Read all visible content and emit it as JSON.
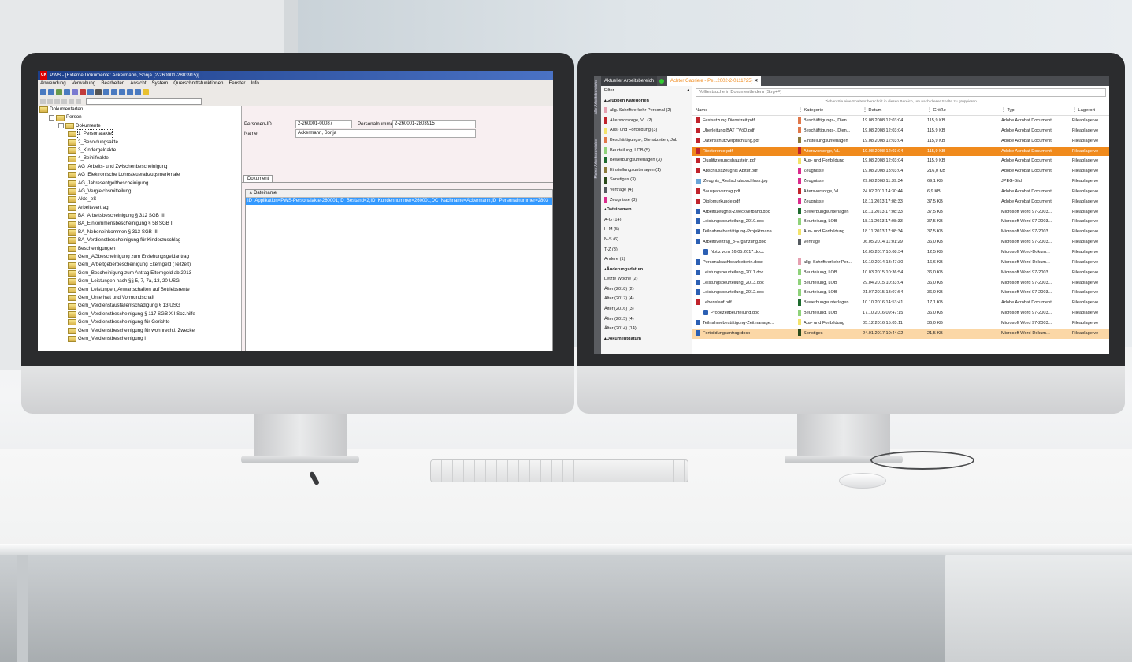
{
  "left_app": {
    "title": "PWS - [Externe Dokumente: Ackermann, Sonja (2-260001-2803915)]",
    "badge": "CK",
    "menu": [
      "Anwendung",
      "Verwaltung",
      "Bearbeiten",
      "Ansicht",
      "System",
      "Querschnittsfunktionen",
      "Fenster",
      "Info"
    ],
    "tree": [
      {
        "label": "Dokumentarten",
        "level": 0
      },
      {
        "label": "Person",
        "level": 1
      },
      {
        "label": "Dokumente",
        "level": 2
      },
      {
        "label": "1_Personalakte",
        "level": 3,
        "selected": true
      },
      {
        "label": "2_Besoldungsakte",
        "level": 3
      },
      {
        "label": "3_Kindergeldakte",
        "level": 3
      },
      {
        "label": "4_Beihilfeakte",
        "level": 3
      },
      {
        "label": "AG_Arbeits- und Zwischenbescheinigung",
        "level": 3
      },
      {
        "label": "AG_Elektronische Lohnsteuerabzugsmerkmale",
        "level": 3
      },
      {
        "label": "AG_Jahresentgeltbescheinigung",
        "level": 3
      },
      {
        "label": "AG_Vergleichsmitteilung",
        "level": 3
      },
      {
        "label": "Akte_eS",
        "level": 3
      },
      {
        "label": "Arbeitsvertrag",
        "level": 3
      },
      {
        "label": "BA_Arbeitsbescheinigung § 312 SGB III",
        "level": 3
      },
      {
        "label": "BA_Einkommensbescheinigung § 58 SGB II",
        "level": 3
      },
      {
        "label": "BA_Nebeneinkommen § 313 SGB III",
        "level": 3
      },
      {
        "label": "BA_Verdienstbescheinigung für Kinderzuschlag",
        "level": 3
      },
      {
        "label": "Bescheinigungen",
        "level": 3
      },
      {
        "label": "Gem_AGbescheinigung zum Erziehungsgeldantrag",
        "level": 3
      },
      {
        "label": "Gem_Arbeitgeberbescheinigung Elterngeld (Teilzeit)",
        "level": 3
      },
      {
        "label": "Gem_Bescheinigung zum Antrag  Elterngeld ab 2013",
        "level": 3
      },
      {
        "label": "Gem_Leistungen nach §§ 5, 7, 7a, 13, 20 USG",
        "level": 3
      },
      {
        "label": "Gem_Leistungen, Anwartschaften auf Betriebsrente",
        "level": 3
      },
      {
        "label": "Gem_Unterhalt und Vormundschaft",
        "level": 3
      },
      {
        "label": "Gem_Verdienstausfallentschädigung § 13 USG",
        "level": 3
      },
      {
        "label": "Gem_Verdienstbescheinigung § 117 SGB XII Soz.hilfe",
        "level": 3
      },
      {
        "label": "Gem_Verdienstbescheinigung für Gerichte",
        "level": 3
      },
      {
        "label": "Gem_Verdienstbescheinigung für wohnrechtl. Zwecke",
        "level": 3
      },
      {
        "label": "Gem_Verdienstbescheinigung I",
        "level": 3
      }
    ],
    "detail": {
      "personen_id_label": "Personen-ID",
      "personen_id_value": "2-260001-00087",
      "personalnummer_label": "Personalnummer",
      "personalnummer_value": "2-260001-2803915",
      "name_label": "Name",
      "name_value": "Ackermann, Sonja",
      "dokument_tab": "Dokument",
      "grid_header": "Dateiname",
      "grid_row": "ID_Applikation=PWS-Personalakte-260001;ID_Bestand=2;ID_Kundennummer=260001;DC_Nachname=Ackermann;ID_Personalnummer=2803"
    }
  },
  "right_app": {
    "tab_workspace": "Aktueller Arbeitsbereich",
    "tab_document": "Achter Gabriele - Pe...2002-2-0111725)",
    "side_labels": [
      "Alle Arbeitsbereiche",
      "Meine Arbeitsbereiche"
    ],
    "filter_label": "Filter",
    "search_placeholder": "Volltextsuche in Dokumentfeldern (Strg+F)",
    "group_hint": "Ziehen Sie eine Spaltenüberschrift in diesen Bereich, um nach dieser Spalte zu gruppieren",
    "filters": [
      {
        "label": "Gruppen Kategorien",
        "head": true
      },
      {
        "label": "allg. Schriftverkehr Personal (2)",
        "color": "#e5a0b0"
      },
      {
        "label": "Altersvorsorge, VL (2)",
        "color": "#c0232b"
      },
      {
        "label": "Aus- und Fortbildung (3)",
        "color": "#f3e36a"
      },
      {
        "label": "Beschäftigungs-, Dienstzeiten, Jub",
        "color": "#e0784a"
      },
      {
        "label": "Beurteilung, LOB (5)",
        "color": "#8fd27a"
      },
      {
        "label": "Bewerbungsunterlagen (3)",
        "color": "#1e6b2e"
      },
      {
        "label": "Einstellungsunterlagen (1)",
        "color": "#8a7a3a"
      },
      {
        "label": "Sonstiges (3)",
        "color": "#2a4a1a"
      },
      {
        "label": "Verträge (4)",
        "color": "#555a60"
      },
      {
        "label": "Zeugnisse (3)",
        "color": "#d92a8c"
      },
      {
        "label": "Dateinamen",
        "head": true
      },
      {
        "label": "A-G (14)"
      },
      {
        "label": "H-M (5)"
      },
      {
        "label": "N-S (6)"
      },
      {
        "label": "T-Z (3)"
      },
      {
        "label": "Andere (1)"
      },
      {
        "label": "Änderungsdatum",
        "head": true
      },
      {
        "label": "Letzte Woche (2)"
      },
      {
        "label": "Älter (2018) (2)"
      },
      {
        "label": "Älter (2017) (4)"
      },
      {
        "label": "Älter (2016) (3)"
      },
      {
        "label": "Älter (2015) (4)"
      },
      {
        "label": "Älter (2014) (14)"
      },
      {
        "label": "Dokumentdatum",
        "head": true
      }
    ],
    "columns": [
      "Name",
      "Kategorie",
      "Datum",
      "Größe",
      "Typ",
      "Lagerort"
    ],
    "rows": [
      {
        "name": "Festsetzung Dienstzeit.pdf",
        "icon": "pdf",
        "cat": "Beschäftigungs-, Dien...",
        "color": "#e0784a",
        "date": "19.08.2008 12:03:04",
        "size": "115,9 KB",
        "type": "Adobe Acrobat Document",
        "loc": "Fileablage ve"
      },
      {
        "name": "Überleitung BAT TVöD.pdf",
        "icon": "pdf",
        "cat": "Beschäftigungs-, Dien...",
        "color": "#e0784a",
        "date": "19.08.2008 12:03:04",
        "size": "115,9 KB",
        "type": "Adobe Acrobat Document",
        "loc": "Fileablage ve"
      },
      {
        "name": "Datenschutzverpflichtung.pdf",
        "icon": "pdf",
        "cat": "Einstellungsunterlagen",
        "color": "#8a7a3a",
        "date": "19.08.2008 12:03:04",
        "size": "115,9 KB",
        "type": "Adobe Acrobat Document",
        "loc": "Fileablage ve"
      },
      {
        "name": "Riesterente.pdf",
        "icon": "pdf",
        "cat": "Altersvorsorge, VL",
        "color": "#c0232b",
        "date": "19.08.2008 12:03:04",
        "size": "115,9 KB",
        "type": "Adobe Acrobat Document",
        "loc": "Fileablage ve",
        "state": "sel"
      },
      {
        "name": "Qualifizierungsbaustein.pdf",
        "icon": "pdf",
        "cat": "Aus- und Fortbildung",
        "color": "#f3e36a",
        "date": "19.08.2008 12:03:04",
        "size": "115,9 KB",
        "type": "Adobe Acrobat Document",
        "loc": "Fileablage ve"
      },
      {
        "name": "Abschlusszeugnis Abitur.pdf",
        "icon": "pdf",
        "cat": "Zeugnisse",
        "color": "#d92a8c",
        "date": "19.08.2008 13:03:04",
        "size": "216,0 KB",
        "type": "Adobe Acrobat Document",
        "loc": "Fileablage ve"
      },
      {
        "name": "Zeugnis_Realschulabschluss.jpg",
        "icon": "img",
        "cat": "Zeugnisse",
        "color": "#d92a8c",
        "date": "29.08.2008 11:39:34",
        "size": "69,1 KB",
        "type": "JPEG-Bild",
        "loc": "Fileablage ve"
      },
      {
        "name": "Bausparvertrag.pdf",
        "icon": "pdf",
        "cat": "Altersvorsorge, VL",
        "color": "#c0232b",
        "date": "24.02.2011 14:30:44",
        "size": "6,9 KB",
        "type": "Adobe Acrobat Document",
        "loc": "Fileablage ve"
      },
      {
        "name": "Diplomurkunde.pdf",
        "icon": "pdf",
        "cat": "Zeugnisse",
        "color": "#d92a8c",
        "date": "18.11.2013 17:08:33",
        "size": "37,5 KB",
        "type": "Adobe Acrobat Document",
        "loc": "Fileablage ve"
      },
      {
        "name": "Arbeitszeugnis-Zweckverband.doc",
        "icon": "doc",
        "cat": "Bewerbungsunterlagen",
        "color": "#1e6b2e",
        "date": "18.11.2013 17:08:33",
        "size": "37,5 KB",
        "type": "Microsoft Word 97-2003...",
        "loc": "Fileablage ve"
      },
      {
        "name": "Leistungsbeurteilung_2010.doc",
        "icon": "doc",
        "cat": "Beurteilung, LOB",
        "color": "#8fd27a",
        "date": "18.11.2013 17:08:33",
        "size": "37,5 KB",
        "type": "Microsoft Word 97-2003...",
        "loc": "Fileablage ve"
      },
      {
        "name": "Teilnahmebestätigung-Projektmana...",
        "icon": "doc",
        "cat": "Aus- und Fortbildung",
        "color": "#f3e36a",
        "date": "18.11.2013 17:08:34",
        "size": "37,5 KB",
        "type": "Microsoft Word 97-2003...",
        "loc": "Fileablage ve"
      },
      {
        "name": "Arbeitsvertrag_3-Ergänzung.doc",
        "icon": "doc",
        "cat": "Verträge",
        "color": "#555a60",
        "date": "06.05.2014 11:01:29",
        "size": "36,0 KB",
        "type": "Microsoft Word 97-2003...",
        "loc": "Fileablage ve"
      },
      {
        "name": "Notiz vom 16.05.2017.docx",
        "icon": "doc",
        "cat": "",
        "color": "",
        "date": "16.05.2017 10:08:34",
        "size": "12,5 KB",
        "type": "Microsoft Word-Dokum...",
        "loc": "Fileablage ve",
        "indent": true
      },
      {
        "name": "Personalsachbearbeiterin.docx",
        "icon": "doc",
        "cat": "allg. Schriftverkehr Per...",
        "color": "#e5a0b0",
        "date": "10.10.2014 13:47:30",
        "size": "16,6 KB",
        "type": "Microsoft Word-Dokum...",
        "loc": "Fileablage ve"
      },
      {
        "name": "Leistungsbeurteilung_2011.doc",
        "icon": "doc",
        "cat": "Beurteilung, LOB",
        "color": "#8fd27a",
        "date": "10.03.2015 10:36:54",
        "size": "36,0 KB",
        "type": "Microsoft Word 97-2003...",
        "loc": "Fileablage ve"
      },
      {
        "name": "Leistungsbeurteilung_2013.doc",
        "icon": "doc",
        "cat": "Beurteilung, LOB",
        "color": "#8fd27a",
        "date": "29.04.2015 10:33:04",
        "size": "36,0 KB",
        "type": "Microsoft Word 97-2003...",
        "loc": "Fileablage ve"
      },
      {
        "name": "Leistungsbeurteilung_2012.doc",
        "icon": "doc",
        "cat": "Beurteilung, LOB",
        "color": "#8fd27a",
        "date": "21.07.2015 13:07:54",
        "size": "36,0 KB",
        "type": "Microsoft Word 97-2003...",
        "loc": "Fileablage ve"
      },
      {
        "name": "Lebenslauf.pdf",
        "icon": "pdf",
        "cat": "Bewerbungsunterlagen",
        "color": "#1e6b2e",
        "date": "10.10.2016 14:53:41",
        "size": "17,1 KB",
        "type": "Adobe Acrobat Document",
        "loc": "Fileablage ve"
      },
      {
        "name": "Probezeitbeurteilung.doc",
        "icon": "doc",
        "cat": "Beurteilung, LOB",
        "color": "#8fd27a",
        "date": "17.10.2016 09:47:15",
        "size": "36,0 KB",
        "type": "Microsoft Word 97-2003...",
        "loc": "Fileablage ve",
        "indent": true
      },
      {
        "name": "Teilnahmebestätigung-Zeitmanage...",
        "icon": "doc",
        "cat": "Aus- und Fortbildung",
        "color": "#f3e36a",
        "date": "05.12.2016 15:05:11",
        "size": "36,0 KB",
        "type": "Microsoft Word 97-2003...",
        "loc": "Fileablage ve"
      },
      {
        "name": "Fortbildungsantrag.docx",
        "icon": "doc",
        "cat": "Sonstiges",
        "color": "#2a4a1a",
        "date": "24.01.2017 10:44:22",
        "size": "21,5 KB",
        "type": "Microsoft Word-Dokum...",
        "loc": "Fileablage ve",
        "state": "hl"
      }
    ]
  }
}
